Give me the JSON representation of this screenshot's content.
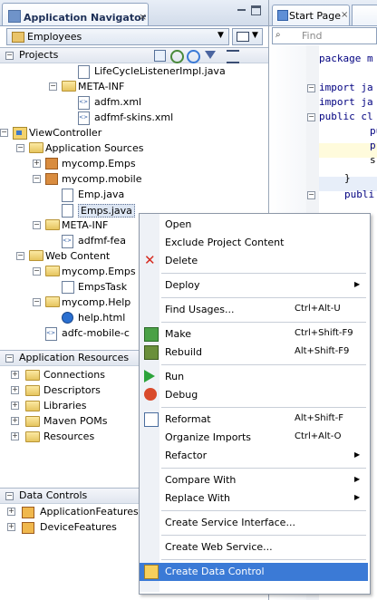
{
  "navigator": {
    "title": "Application Navigator",
    "close_glyph": "×",
    "app_selector": "Employees",
    "sections": {
      "projects": "Projects",
      "application_resources": "Application Resources",
      "data_controls": "Data Controls"
    },
    "tree": [
      {
        "label": "LifeCycleListenerImpl.java",
        "icon": "java-file-icon",
        "level": 5
      },
      {
        "label": "META-INF",
        "icon": "folder-icon",
        "level": 4,
        "expanded": true
      },
      {
        "label": "adfm.xml",
        "icon": "xml-file-icon",
        "level": 5
      },
      {
        "label": "adfmf-skins.xml",
        "icon": "xml-file-icon",
        "level": 5
      },
      {
        "label": "ViewController",
        "icon": "project-icon",
        "level": 1,
        "expanded": true
      },
      {
        "label": "Application Sources",
        "icon": "folder-icon",
        "level": 2,
        "expanded": true
      },
      {
        "label": "mycomp.Emps",
        "icon": "package-icon",
        "level": 3,
        "expanded": false
      },
      {
        "label": "mycomp.mobile",
        "icon": "package-icon",
        "level": 3,
        "expanded": true
      },
      {
        "label": "Emp.java",
        "icon": "java-file-icon",
        "level": 4
      },
      {
        "label": "Emps.java",
        "icon": "java-file-icon",
        "level": 4,
        "selected": true
      },
      {
        "label": "META-INF",
        "icon": "folder-icon",
        "level": 3,
        "expanded": true
      },
      {
        "label": "adfmf-fea",
        "icon": "xml-file-icon",
        "level": 4
      },
      {
        "label": "Web Content",
        "icon": "folder-icon",
        "level": 2,
        "expanded": true
      },
      {
        "label": "mycomp.Emps",
        "icon": "folder-icon",
        "level": 3,
        "expanded": true
      },
      {
        "label": "EmpsTask",
        "icon": "taskflow-icon",
        "level": 4
      },
      {
        "label": "mycomp.Help",
        "icon": "folder-icon",
        "level": 3,
        "expanded": true
      },
      {
        "label": "help.html",
        "icon": "help-file-icon",
        "level": 4
      },
      {
        "label": "adfc-mobile-c",
        "icon": "xml-file-icon",
        "level": 3
      }
    ],
    "resources": [
      "Connections",
      "Descriptors",
      "Libraries",
      "Maven POMs",
      "Resources"
    ],
    "data_controls": [
      "ApplicationFeatures",
      "DeviceFeatures"
    ]
  },
  "editor": {
    "tab_label": "Start Page",
    "close_glyph": "×",
    "find_placeholder": "Find",
    "find_glyph": "⌕",
    "code": [
      {
        "text": "package m",
        "kw": true
      },
      {
        "text": "import ja",
        "kw": true
      },
      {
        "text": "import ja",
        "kw": true
      },
      {
        "text": "public cl",
        "kw": true
      },
      {
        "text": "pu",
        "kw": true
      },
      {
        "text": "pr",
        "kw": true
      },
      {
        "text": "s",
        "kw": false
      },
      {
        "text": "}",
        "kw": false
      },
      {
        "text": "publi",
        "kw": true
      }
    ]
  },
  "context_menu": {
    "items": [
      {
        "label": "Open",
        "accel": "",
        "submenu": false,
        "icon": ""
      },
      {
        "label": "Exclude Project Content",
        "accel": "",
        "submenu": false,
        "icon": ""
      },
      {
        "label": "Delete",
        "accel": "",
        "submenu": false,
        "icon": "delete-icon"
      },
      {
        "sep": true
      },
      {
        "label": "Deploy",
        "accel": "",
        "submenu": true,
        "icon": ""
      },
      {
        "sep": true
      },
      {
        "label": "Find Usages...",
        "accel": "Ctrl+Alt-U",
        "submenu": false,
        "icon": ""
      },
      {
        "sep": true
      },
      {
        "label": "Make",
        "accel": "Ctrl+Shift-F9",
        "submenu": false,
        "icon": "make-icon"
      },
      {
        "label": "Rebuild",
        "accel": "Alt+Shift-F9",
        "submenu": false,
        "icon": "rebuild-icon"
      },
      {
        "sep": true
      },
      {
        "label": "Run",
        "accel": "",
        "submenu": false,
        "icon": "run-icon"
      },
      {
        "label": "Debug",
        "accel": "",
        "submenu": false,
        "icon": "debug-icon"
      },
      {
        "sep": true
      },
      {
        "label": "Reformat",
        "accel": "Alt+Shift-F",
        "submenu": false,
        "icon": "reformat-icon"
      },
      {
        "label": "Organize Imports",
        "accel": "Ctrl+Alt-O",
        "submenu": false,
        "icon": ""
      },
      {
        "label": "Refactor",
        "accel": "",
        "submenu": true,
        "icon": ""
      },
      {
        "sep": true
      },
      {
        "label": "Compare With",
        "accel": "",
        "submenu": true,
        "icon": ""
      },
      {
        "label": "Replace With",
        "accel": "",
        "submenu": true,
        "icon": ""
      },
      {
        "sep": true
      },
      {
        "label": "Create Service Interface...",
        "accel": "",
        "submenu": false,
        "icon": ""
      },
      {
        "sep": true
      },
      {
        "label": "Create Web Service...",
        "accel": "",
        "submenu": false,
        "icon": ""
      },
      {
        "sep": true
      },
      {
        "label": "Create Data Control",
        "accel": "",
        "submenu": false,
        "icon": "data-control-icon",
        "highlighted": true
      }
    ]
  }
}
